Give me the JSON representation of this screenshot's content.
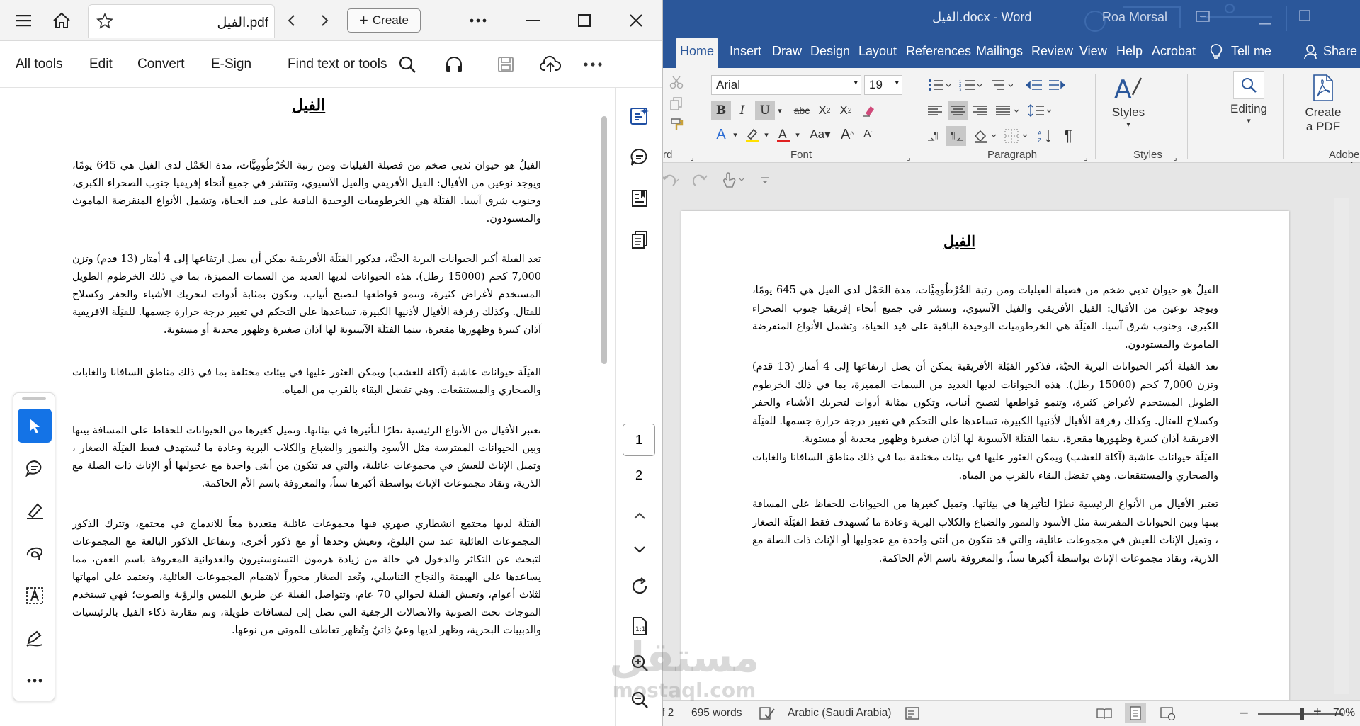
{
  "acrobat": {
    "tab_title": "الفيل.pdf",
    "create_label": "Create",
    "toolbar": {
      "all_tools": "All tools",
      "edit": "Edit",
      "convert": "Convert",
      "esign": "E-Sign",
      "find": "Find text or tools"
    },
    "page_current": "1",
    "page_next": "2",
    "doc_title": "الفيل",
    "paragraphs": [
      "الفيلُ هو حيوان ثديي ضخم من فصيلة الفيليات ومن رتبة الخُرْطُومِيَّات، مدة الحَمْل لدى الفيل هي 645 يومًا، ويوجد نوعين من الأفيال: الفيل الأفريقي والفيل الآسيوي، وتنتشر في جميع أنحاء إفريقيا جنوب الصحراء الكبرى، وجنوب شرق آسيا. الفيَلَة هي الخرطوميات الوحيدة الباقية على قيد الحياة، وتشمل الأنواع المنقرضة الماموث والمستودون.",
      "تعد الفيلة أكبر الحيوانات البرية الحيَّة، فذكور الفيَلَة الأفريقية يمكن أن يصل ارتفاعها إلى 4 أمتار (13 قدم) وتزن 7,000 كجم (15000 رطل). هذه الحيوانات لديها العديد من السمات المميزة، بما في ذلك الخرطوم الطويل المستخدم لأغراض كثيرة، وتنمو قواطعها لتصبح أنياب، وتكون بمثابة أدوات لتحريك الأشياء والحفر وكسلاح للقتال. وكذلك رفرفة الأفيال لأذنيها الكبيرة، تساعدها على التحكم في تغيير درجة حرارة جسمها. للفيَلَة الافريقية آذان كبيرة وظهورها مقعرة، بينما الفيَلَة الآسيوية لها آذان صغيرة وظهور محدبة أو مستوية.",
      "الفيَلَة حيوانات عاشبة (آكلة للعشب) ويمكن العثور عليها في بيئات مختلفة بما في ذلك مناطق السافانا والغابات والصحاري والمستنقعات. وهي تفضل البقاء بالقرب من المياه.",
      "تعتبر الأفيال من الأنواع الرئيسية نظرًا لتأثيرها في بيئاتها. وتميل كغيرها من الحيوانات للحفاظ على المسافة بينها وبين الحيوانات المفترسة مثل الأسود والنمور والضباع والكلاب البرية وعادة ما تُستهدف فقط الفيَلَة الصغار ، وتميل الإناث للعيش في مجموعات عائلية، والتي قد تتكون من أنثى واحدة مع عجوليها أو الإناث ذات الصلة مع الذرية، وتقاد مجموعات الإناث بواسطة أكبرها سناً، والمعروفة باسم الأم الحاكمة.",
      "الفيَلَة لديها مجتمع انشطاري صهري فيها مجموعات عائلية متعددة معاً للاندماج في مجتمع، وتترك الذكور المجموعات العائلية عند سن البلوغ، وتعيش وحدها أو مع ذكور أخرى، وتتفاعل الذكور البالغة مع المجموعات لتبحث عن التكاثر والدخول في حالة من زيادة هرمون التستوستيرون والعدوانية المعروفة باسم العفن، مما يساعدها على الهيمنة والنجاح التناسلي، وتُعد الصغار محوراً لاهتمام المجموعات العائلية، وتعتمد على امهاتها لثلاث أعوام، وتعيش الفيلة لحوالي 70 عام، وتتواصل الفيلة عن طريق اللمس والرؤية والصوت؛ فهي تستخدم الموجات تحت الصوتية والاتصالات الرجفية التي تصل إلى لمسافات طويلة، وتم مقارنة ذكاء الفيل بالرئيسيات والدبيبات البحرية، وظهر لديها وعيٌ ذاتيٌ وتُظهر تعاطف للموتى من نوعها."
    ]
  },
  "word": {
    "title": "الفيل.docx  -  Word",
    "user": "Roa Morsal",
    "share": "Share",
    "tabs": [
      "Home",
      "Insert",
      "Draw",
      "Design",
      "Layout",
      "References",
      "Mailings",
      "Review",
      "View",
      "Help",
      "Acrobat"
    ],
    "tell_me": "Tell me",
    "font_name": "Arial",
    "font_size": "19",
    "group_clipboard_tail": "rd",
    "group_font": "Font",
    "group_paragraph": "Paragraph",
    "group_styles": "Styles",
    "group_acrobat": "Adobe Acrobat",
    "styles_label": "Styles",
    "editing_label": "Editing",
    "create_pdf_1": "Create",
    "create_pdf_2": "a PDF",
    "doc_title": "الفيل",
    "status": {
      "page": "f 2",
      "words": "695 words",
      "language": "Arabic (Saudi Arabia)",
      "zoom": "70%"
    }
  },
  "watermark": {
    "line1": "مستقل",
    "line2": "mostaql.com"
  },
  "colors": {
    "word_blue": "#2b579a",
    "acrobat_accent": "#1473e6"
  }
}
